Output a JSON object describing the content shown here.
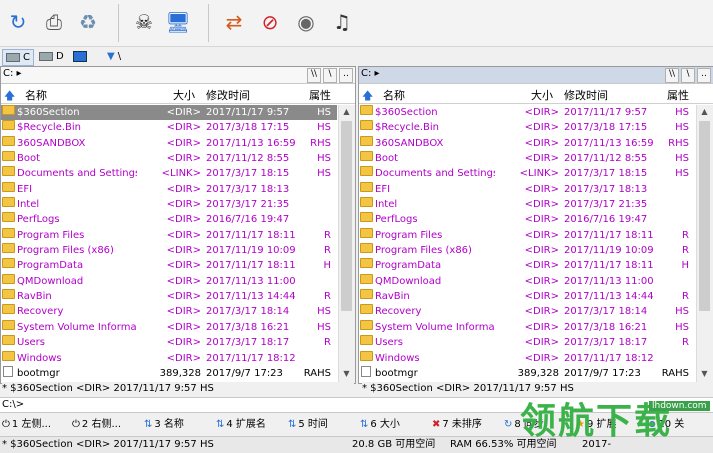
{
  "toolbar": {
    "icons": [
      "refresh-icon",
      "printer-icon",
      "recycle-bin-icon",
      "skull-icon",
      "monitor-icon",
      "network-icon",
      "no-entry-icon",
      "disk-icon",
      "music-icon"
    ]
  },
  "drives": {
    "items": [
      {
        "label": "C",
        "icon": "drive-icon"
      },
      {
        "label": "D",
        "icon": "drive-icon"
      },
      {
        "label": "",
        "icon": "monitor-icon"
      },
      {
        "label": "\\",
        "icon": "network-icon"
      }
    ]
  },
  "left": {
    "path": "C:",
    "header": {
      "name": "名称",
      "size": "大小",
      "date": "修改时间",
      "attr": "属性"
    },
    "rows": [
      {
        "name": "$360Section",
        "size": "<DIR>",
        "date": "2017/11/17  9:57",
        "attr": "HS"
      },
      {
        "name": "$Recycle.Bin",
        "size": "<DIR>",
        "date": "2017/3/18  17:15",
        "attr": "HS"
      },
      {
        "name": "360SANDBOX",
        "size": "<DIR>",
        "date": "2017/11/13  16:59",
        "attr": "RHS"
      },
      {
        "name": "Boot",
        "size": "<DIR>",
        "date": "2017/11/12  8:55",
        "attr": "HS"
      },
      {
        "name": "Documents and Settings",
        "size": "<LINK>",
        "date": "2017/3/17  18:15",
        "attr": "HS"
      },
      {
        "name": "EFI",
        "size": "<DIR>",
        "date": "2017/3/17  18:13",
        "attr": ""
      },
      {
        "name": "Intel",
        "size": "<DIR>",
        "date": "2017/3/17  21:35",
        "attr": ""
      },
      {
        "name": "PerfLogs",
        "size": "<DIR>",
        "date": "2016/7/16  19:47",
        "attr": ""
      },
      {
        "name": "Program Files",
        "size": "<DIR>",
        "date": "2017/11/17  18:11",
        "attr": "R"
      },
      {
        "name": "Program Files (x86)",
        "size": "<DIR>",
        "date": "2017/11/19  10:09",
        "attr": "R"
      },
      {
        "name": "ProgramData",
        "size": "<DIR>",
        "date": "2017/11/17  18:11",
        "attr": "H"
      },
      {
        "name": "QMDownload",
        "size": "<DIR>",
        "date": "2017/11/13  11:00",
        "attr": ""
      },
      {
        "name": "RavBin",
        "size": "<DIR>",
        "date": "2017/11/13  14:44",
        "attr": "R"
      },
      {
        "name": "Recovery",
        "size": "<DIR>",
        "date": "2017/3/17  18:14",
        "attr": "HS"
      },
      {
        "name": "System Volume Informa...",
        "size": "<DIR>",
        "date": "2017/3/18  16:21",
        "attr": "HS"
      },
      {
        "name": "Users",
        "size": "<DIR>",
        "date": "2017/3/17  18:17",
        "attr": "R"
      },
      {
        "name": "Windows",
        "size": "<DIR>",
        "date": "2017/11/17  18:12",
        "attr": ""
      },
      {
        "name": "bootmgr",
        "size": "389,328",
        "date": "2017/9/7  17:23",
        "attr": "RAHS"
      }
    ],
    "status": "* $360Section   <DIR>  2017/11/17  9:57  HS"
  },
  "right": {
    "path": "C:",
    "header": {
      "name": "名称",
      "size": "大小",
      "date": "修改时间",
      "attr": "属性"
    },
    "rows": [
      {
        "name": "$360Section",
        "size": "<DIR>",
        "date": "2017/11/17  9:57",
        "attr": "HS"
      },
      {
        "name": "$Recycle.Bin",
        "size": "<DIR>",
        "date": "2017/3/18  17:15",
        "attr": "HS"
      },
      {
        "name": "360SANDBOX",
        "size": "<DIR>",
        "date": "2017/11/13  16:59",
        "attr": "RHS"
      },
      {
        "name": "Boot",
        "size": "<DIR>",
        "date": "2017/11/12  8:55",
        "attr": "HS"
      },
      {
        "name": "Documents and Settings",
        "size": "<LINK>",
        "date": "2017/3/17  18:15",
        "attr": "HS"
      },
      {
        "name": "EFI",
        "size": "<DIR>",
        "date": "2017/3/17  18:13",
        "attr": ""
      },
      {
        "name": "Intel",
        "size": "<DIR>",
        "date": "2017/3/17  21:35",
        "attr": ""
      },
      {
        "name": "PerfLogs",
        "size": "<DIR>",
        "date": "2016/7/16  19:47",
        "attr": ""
      },
      {
        "name": "Program Files",
        "size": "<DIR>",
        "date": "2017/11/17  18:11",
        "attr": "R"
      },
      {
        "name": "Program Files (x86)",
        "size": "<DIR>",
        "date": "2017/11/19  10:09",
        "attr": "R"
      },
      {
        "name": "ProgramData",
        "size": "<DIR>",
        "date": "2017/11/17  18:11",
        "attr": "H"
      },
      {
        "name": "QMDownload",
        "size": "<DIR>",
        "date": "2017/11/13  11:00",
        "attr": ""
      },
      {
        "name": "RavBin",
        "size": "<DIR>",
        "date": "2017/11/13  14:44",
        "attr": "R"
      },
      {
        "name": "Recovery",
        "size": "<DIR>",
        "date": "2017/3/17  18:14",
        "attr": "HS"
      },
      {
        "name": "System Volume Informa...",
        "size": "<DIR>",
        "date": "2017/3/18  16:21",
        "attr": "HS"
      },
      {
        "name": "Users",
        "size": "<DIR>",
        "date": "2017/3/17  18:17",
        "attr": "R"
      },
      {
        "name": "Windows",
        "size": "<DIR>",
        "date": "2017/11/17  18:12",
        "attr": ""
      },
      {
        "name": "bootmgr",
        "size": "389,328",
        "date": "2017/9/7  17:23",
        "attr": "RAHS"
      }
    ],
    "status": "* $360Section   <DIR>  2017/11/17  9:57  HS"
  },
  "cmdline": "C:\\>",
  "fkeys": [
    {
      "label": "1 左侧...",
      "icon": "power-icon"
    },
    {
      "label": "2 右侧...",
      "icon": "power-icon"
    },
    {
      "label": "3 名称",
      "icon": "sort-icon"
    },
    {
      "label": "4 扩展名",
      "icon": "sort-icon"
    },
    {
      "label": "5 时间",
      "icon": "sort-icon"
    },
    {
      "label": "6 大小",
      "icon": "sort-icon"
    },
    {
      "label": "7 未排序",
      "icon": "close-icon"
    },
    {
      "label": "8 同步",
      "icon": "refresh-icon"
    },
    {
      "label": "9 扩展",
      "icon": "star-icon"
    },
    {
      "label": "10 关",
      "icon": "exit-icon"
    }
  ],
  "bottomstatus": {
    "item": "* $360Section   <DIR>  2017/11/17  9:57  HS",
    "disk": "20.8 GB 可用空间",
    "ram": "RAM 66.53% 可用空间",
    "date": "2017-"
  },
  "watermark": {
    "text": "领航下载",
    "url": "lhdown.com"
  },
  "colors": {
    "dir": "#b000c8",
    "selected": "#8a8a8a",
    "folder": "#f4c542"
  }
}
